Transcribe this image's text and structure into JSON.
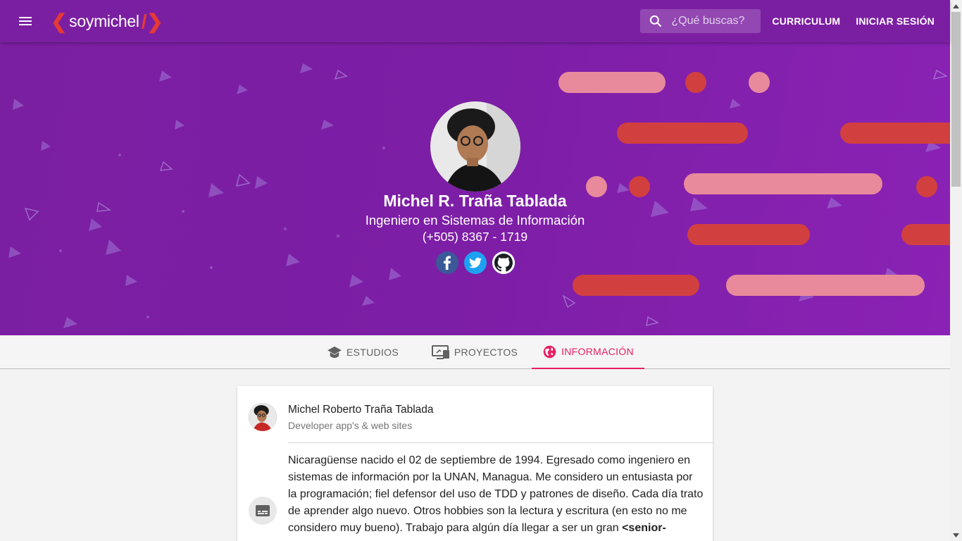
{
  "header": {
    "logo_left": "❮",
    "logo_text": "soymichel",
    "logo_right": "/❯",
    "search_placeholder": "¿Qué buscas?",
    "links": [
      "CURRICULUM",
      "INICIAR SESIÓN"
    ]
  },
  "hero": {
    "name": "Michel R. Traña Tablada",
    "role": "Ingeniero en Sistemas de Información",
    "phone": "(+505) 8367 - 1719",
    "socials": [
      "facebook-icon",
      "twitter-icon",
      "github-icon"
    ]
  },
  "tabs": [
    {
      "label": "ESTUDIOS",
      "icon": "graduation-cap-icon",
      "active": false
    },
    {
      "label": "PROYECTOS",
      "icon": "monitor-devices-icon",
      "active": false
    },
    {
      "label": "INFORMACIÓN",
      "icon": "globe-icon",
      "active": true
    }
  ],
  "card": {
    "name": "Michel Roberto Traña Tablada",
    "subtitle": "Developer app's & web sites",
    "description": "Nicaragüense nacido el 02 de septiembre de 1994. Egresado como ingeniero en sistemas de información por la UNAN, Managua. Me considero un entusiasta por la programación; fiel defensor del uso de TDD y patrones de diseño. Cada día trato de aprender algo nuevo. Otros hobbies son la lectura y escritura (en esto no me considero muy bueno). Trabajo para algún día llegar a ser un gran",
    "description_bold": "<senior-"
  },
  "colors": {
    "primary": "#7b1fa2",
    "accent": "#e91e63",
    "pill_dark": "#d23f3f",
    "pill_light": "#e88a9c"
  }
}
